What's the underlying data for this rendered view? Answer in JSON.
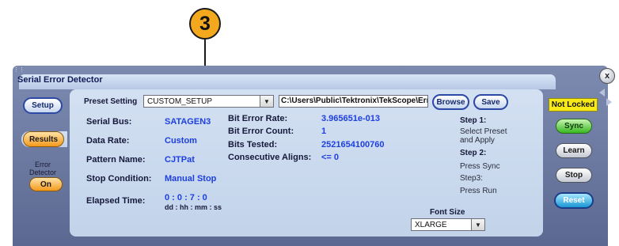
{
  "callout": {
    "number": "3"
  },
  "window": {
    "title": "Serial Error Detector",
    "close_glyph": "x",
    "grip_glyph": "⋮⋮"
  },
  "left_nav": {
    "setup_label": "Setup",
    "results_label": "Results",
    "error_detector_label_line1": "Error",
    "error_detector_label_line2": "Detector",
    "on_label": "On"
  },
  "preset": {
    "label": "Preset Setting",
    "value": "CUSTOM_SETUP",
    "path": "C:\\Users\\Public\\Tektronix\\TekScope\\Err",
    "browse_label": "Browse",
    "save_label": "Save"
  },
  "fields": {
    "serial_bus": {
      "label": "Serial Bus:",
      "value": "SATAGEN3"
    },
    "data_rate": {
      "label": "Data Rate:",
      "value": "Custom"
    },
    "pattern_name": {
      "label": "Pattern Name:",
      "value": "CJTPat"
    },
    "stop_condition": {
      "label": "Stop Condition:",
      "value": "Manual Stop"
    },
    "elapsed_time": {
      "label": "Elapsed Time:",
      "value": "0 : 0 : 7 : 0",
      "format": "dd : hh : mm : ss"
    }
  },
  "stats": {
    "bit_error_rate": {
      "label": "Bit Error Rate:",
      "value": "3.965651e-013"
    },
    "bit_error_count": {
      "label": "Bit Error Count:",
      "value": "1"
    },
    "bits_tested": {
      "label": "Bits Tested:",
      "value": "2521654100760"
    },
    "consecutive_aligns": {
      "label": "Consecutive Aligns:",
      "value": "<= 0"
    }
  },
  "steps": {
    "step1_title": "Step 1:",
    "step1_line1": "Select Preset",
    "step1_line2": "and Apply",
    "step2_title": "Step 2:",
    "step2_text": "Press Sync",
    "step3_title": "Step3:",
    "step3_text": "Press Run"
  },
  "font_size": {
    "label": "Font Size",
    "value": "XLARGE"
  },
  "right_panel": {
    "status": "Not Locked",
    "sync_label": "Sync",
    "learn_label": "Learn",
    "stop_label": "Stop",
    "reset_label": "Reset"
  },
  "colors": {
    "accent_value_blue": "#1d3fe0",
    "status_yellow": "#f7ea17",
    "sync_green": "#37b820",
    "reset_cyan": "#1a97d3",
    "callout_orange": "#f4a81d"
  }
}
